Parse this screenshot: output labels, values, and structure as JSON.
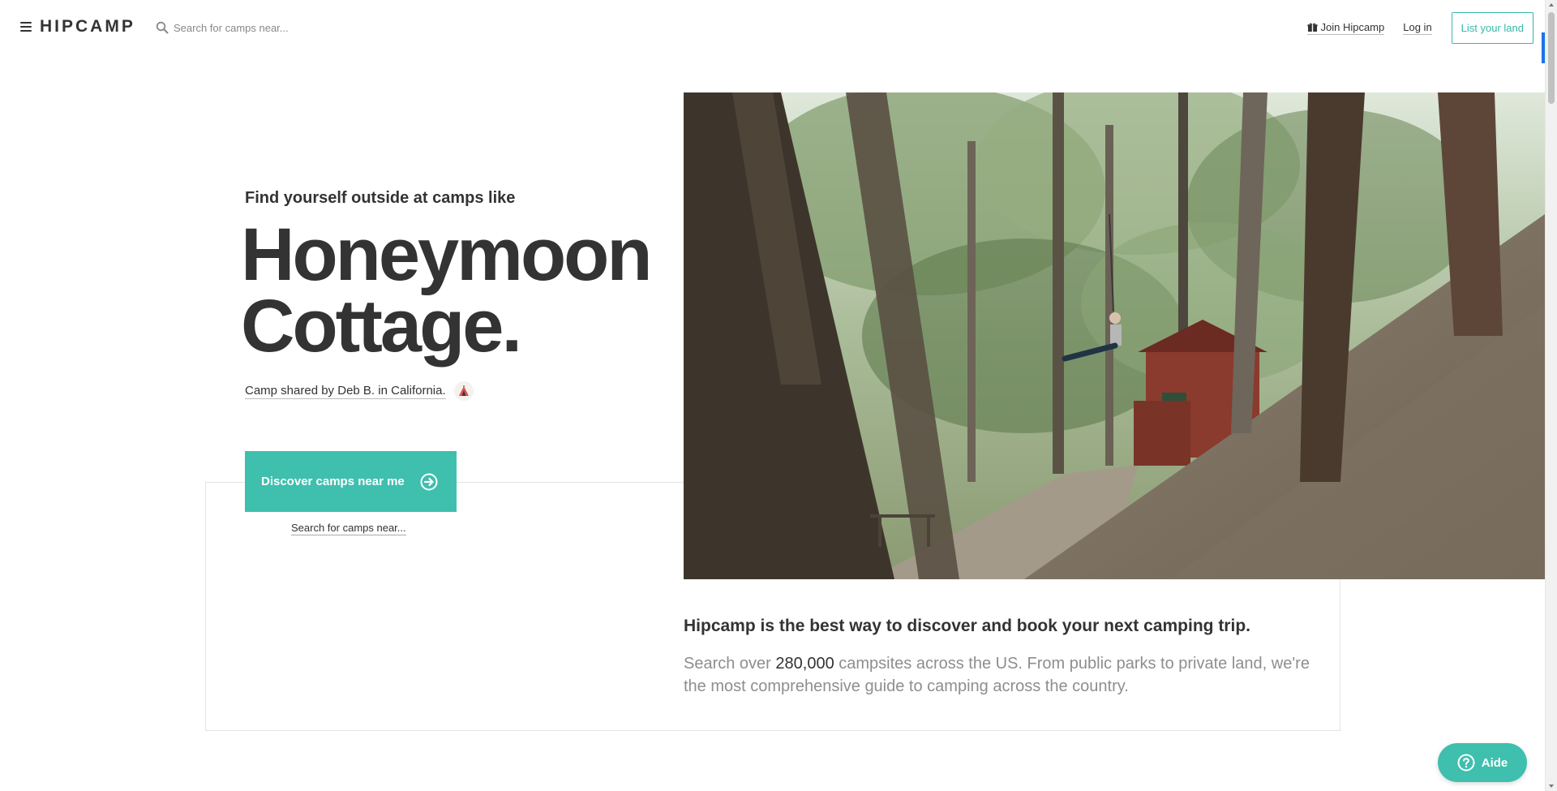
{
  "nav": {
    "logo": "HIPCAMP",
    "search_placeholder": "Search for camps near...",
    "join_label": "Join Hipcamp",
    "login_label": "Log in",
    "list_land_label": "List your land"
  },
  "hero": {
    "eyebrow": "Find yourself outside at camps like",
    "title_line1": "Honeymoon",
    "title_line2": "Cottage.",
    "shared_prefix": "Camp shared by ",
    "shared_host": "Deb B.",
    "shared_mid": " in ",
    "shared_location": "California",
    "shared_suffix": ".",
    "discover_label": "Discover camps near me",
    "search_link": "Search for camps near..."
  },
  "pitch": {
    "title": "Hipcamp is the best way to discover and book your next camping trip.",
    "body_prefix": "Search over ",
    "body_number": "280,000",
    "body_suffix": " campsites across the US. From public parks to private land, we're the most comprehensive guide to camping across the country."
  },
  "help": {
    "label": "Aide"
  },
  "colors": {
    "accent": "#3fbfae",
    "text": "#333333",
    "muted": "#8e8e8e"
  },
  "icons": {
    "menu": "hamburger-icon",
    "search": "search-icon",
    "gift": "gift-icon",
    "tent": "tent-icon",
    "arrow": "arrow-circle-right-icon",
    "help": "question-circle-icon"
  }
}
